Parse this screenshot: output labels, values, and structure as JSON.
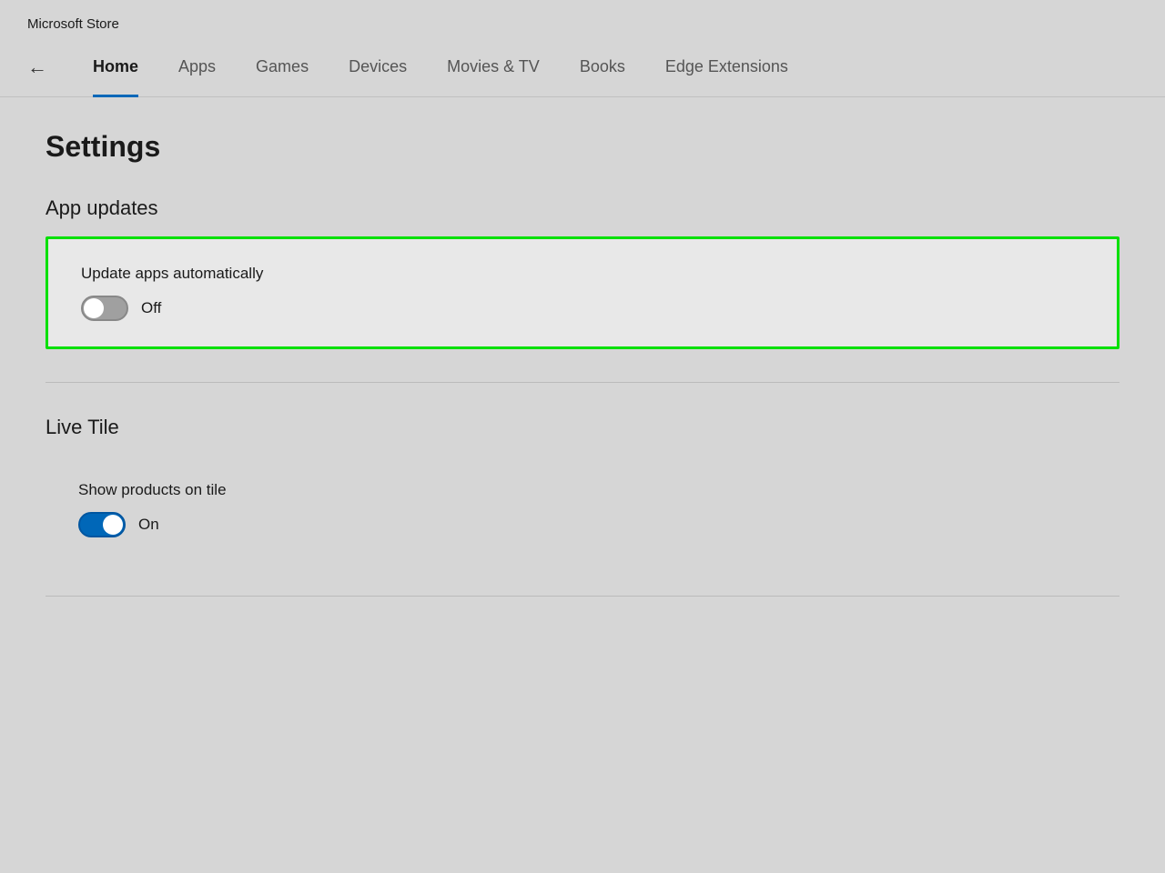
{
  "titleBar": {
    "label": "Microsoft Store"
  },
  "nav": {
    "backIcon": "←",
    "items": [
      {
        "id": "home",
        "label": "Home",
        "active": true
      },
      {
        "id": "apps",
        "label": "Apps",
        "active": false
      },
      {
        "id": "games",
        "label": "Games",
        "active": false
      },
      {
        "id": "devices",
        "label": "Devices",
        "active": false
      },
      {
        "id": "movies-tv",
        "label": "Movies & TV",
        "active": false
      },
      {
        "id": "books",
        "label": "Books",
        "active": false
      },
      {
        "id": "edge-extensions",
        "label": "Edge Extensions",
        "active": false
      }
    ]
  },
  "page": {
    "title": "Settings"
  },
  "sections": [
    {
      "id": "app-updates",
      "title": "App updates",
      "settings": [
        {
          "id": "update-apps-automatically",
          "label": "Update apps automatically",
          "toggle": {
            "state": "off",
            "label": "Off"
          },
          "highlighted": true
        }
      ]
    },
    {
      "id": "live-tile",
      "title": "Live Tile",
      "settings": [
        {
          "id": "show-products-on-tile",
          "label": "Show products on tile",
          "toggle": {
            "state": "on",
            "label": "On"
          },
          "highlighted": false
        }
      ]
    }
  ]
}
